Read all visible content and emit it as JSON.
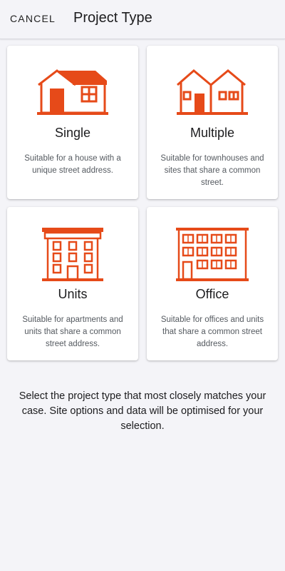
{
  "header": {
    "cancel_label": "CANCEL",
    "title": "Project Type"
  },
  "accent_color": "#e64a19",
  "cards": [
    {
      "icon": "single-house-icon",
      "name": "Single",
      "description": "Suitable for a house with a unique street address."
    },
    {
      "icon": "multiple-houses-icon",
      "name": "Multiple",
      "description": "Suitable for townhouses and sites that share a common street."
    },
    {
      "icon": "apartment-building-icon",
      "name": "Units",
      "description": "Suitable for apartments and units that share a common street address."
    },
    {
      "icon": "office-building-icon",
      "name": "Office",
      "description": "Suitable for offices and units that share a common street address."
    }
  ],
  "footer": {
    "instruction": "Select the project type that most closely matches your case. Site options and data will be optimised for your selection."
  }
}
